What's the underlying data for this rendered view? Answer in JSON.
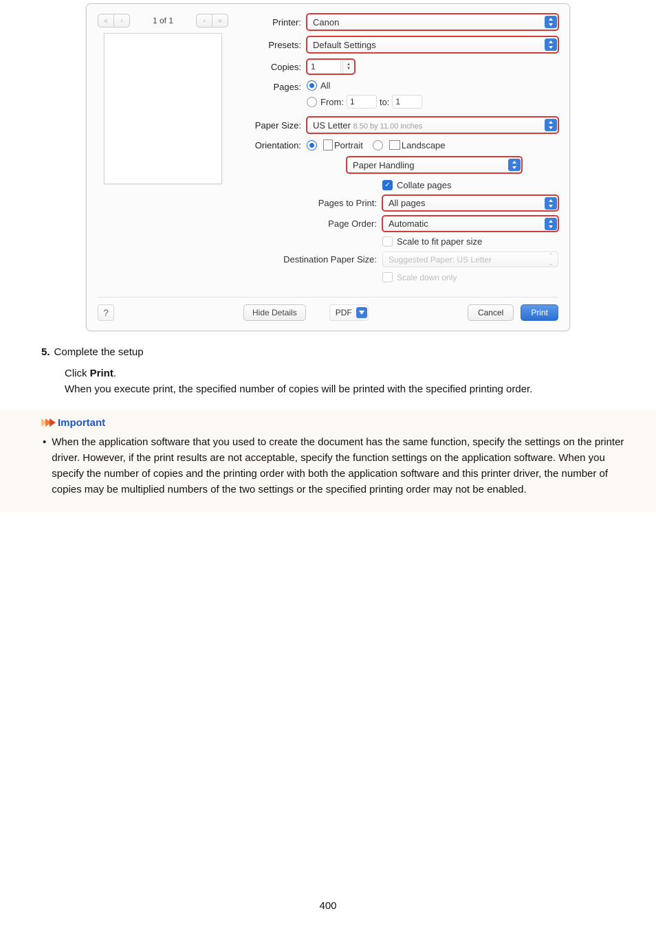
{
  "dialog": {
    "page_nav": "1 of 1",
    "rows": {
      "printer_label": "Printer:",
      "printer_value": "Canon",
      "presets_label": "Presets:",
      "presets_value": "Default Settings",
      "copies_label": "Copies:",
      "copies_value": "1",
      "pages_label": "Pages:",
      "pages_all": "All",
      "pages_from": "From:",
      "pages_from_val": "1",
      "pages_to": "to:",
      "pages_to_val": "1",
      "papersize_label": "Paper Size:",
      "papersize_value": "US Letter",
      "papersize_dim": "8.50 by 11.00 inches",
      "orientation_label": "Orientation:",
      "orientation_portrait": "Portrait",
      "orientation_landscape": "Landscape",
      "section_value": "Paper Handling",
      "collate": "Collate pages",
      "pages_to_print_label": "Pages to Print:",
      "pages_to_print_value": "All pages",
      "page_order_label": "Page Order:",
      "page_order_value": "Automatic",
      "scale_fit": "Scale to fit paper size",
      "dest_paper_label": "Destination Paper Size:",
      "dest_paper_value": "Suggested Paper: US Letter",
      "scale_down": "Scale down only",
      "hide_details": "Hide Details",
      "pdf": "PDF",
      "cancel": "Cancel",
      "print": "Print"
    }
  },
  "step": {
    "num": "5.",
    "title": "Complete the setup",
    "click": "Click ",
    "click_bold": "Print",
    "click_end": ".",
    "desc": "When you execute print, the specified number of copies will be printed with the specified printing order."
  },
  "important": {
    "heading": "Important",
    "text": "When the application software that you used to create the document has the same function, specify the settings on the printer driver. However, if the print results are not acceptable, specify the function settings on the application software. When you specify the number of copies and the printing order with both the application software and this printer driver, the number of copies may be multiplied numbers of the two settings or the specified printing order may not be enabled."
  },
  "page_number": "400"
}
